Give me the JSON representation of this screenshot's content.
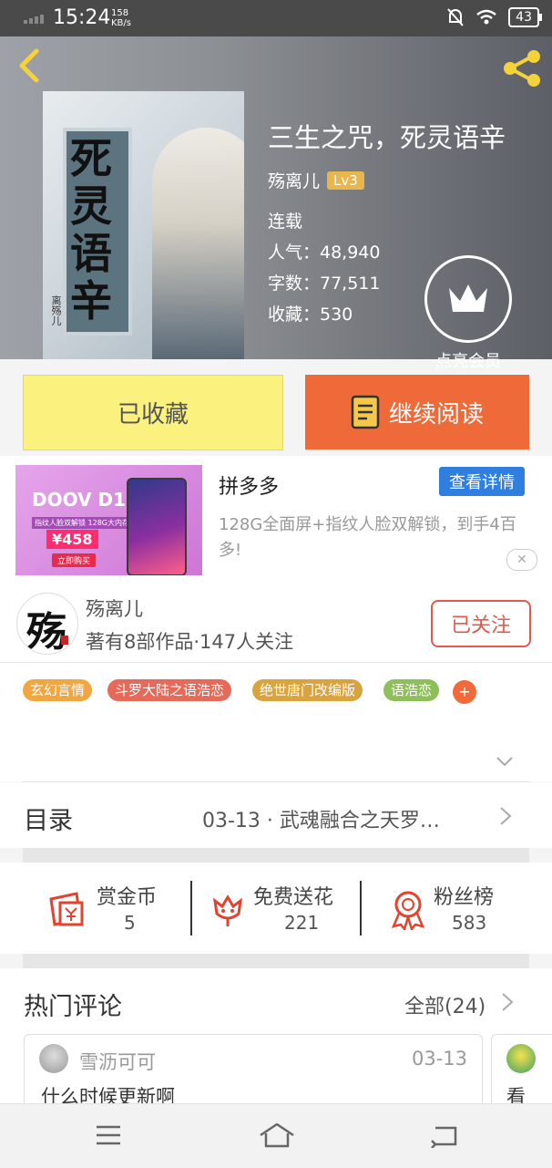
{
  "status_bar": {
    "time": "15:24",
    "net_speed": "158",
    "net_unit": "KB/s",
    "battery": "43"
  },
  "book": {
    "title": "三生之咒，死灵语辛",
    "author": "殇离儿",
    "level": "Lv3",
    "status": "连载",
    "popularity": "人气：48,940",
    "word_count": "字数：77,511",
    "favorites": "收藏：530",
    "cover_title": "死灵语辛",
    "cover_author": "离殇儿"
  },
  "vip": {
    "label": "点亮会员"
  },
  "actions": {
    "collected_label": "已收藏",
    "continue_label": "继续阅读"
  },
  "ad": {
    "title": "拼多多",
    "detail_button": "查看详情",
    "description": "128G全面屏+指纹人脸双解锁，到手4百多!",
    "banner_brand": "DOOV D1",
    "banner_sub": "指纹人脸双解锁 128G大内存",
    "banner_price": "¥458",
    "banner_buy": "立即购买",
    "close": "✕"
  },
  "author_card": {
    "name": "殇离儿",
    "stats": "著有8部作品·147人关注",
    "follow_label": "已关注"
  },
  "tags": [
    {
      "label": "玄幻言情",
      "color": "#f0a742"
    },
    {
      "label": "斗罗大陆之语浩恋",
      "color": "#e56a5a"
    },
    {
      "label": "绝世唐门改编版",
      "color": "#d9a33f"
    },
    {
      "label": "语浩恋",
      "color": "#8fbf5a"
    }
  ],
  "tag_more": "+",
  "toc": {
    "label": "目录",
    "latest": "03-13 · 武魂融合之天罗…"
  },
  "rewards": [
    {
      "title": "赏金币",
      "value": "5",
      "icon": "coin-envelope-icon",
      "color": "#e2432f"
    },
    {
      "title": "免费送花",
      "value": "221",
      "icon": "flower-icon",
      "color": "#e2432f"
    },
    {
      "title": "粉丝榜",
      "value": "583",
      "icon": "medal-icon",
      "color": "#e2432f"
    }
  ],
  "comments": {
    "title": "热门评论",
    "all": "全部(24)",
    "items": [
      {
        "user": "雪沥可可",
        "date": "03-13",
        "text": "什么时候更新啊"
      },
      {
        "user": "",
        "date": "",
        "text": "看"
      }
    ]
  }
}
